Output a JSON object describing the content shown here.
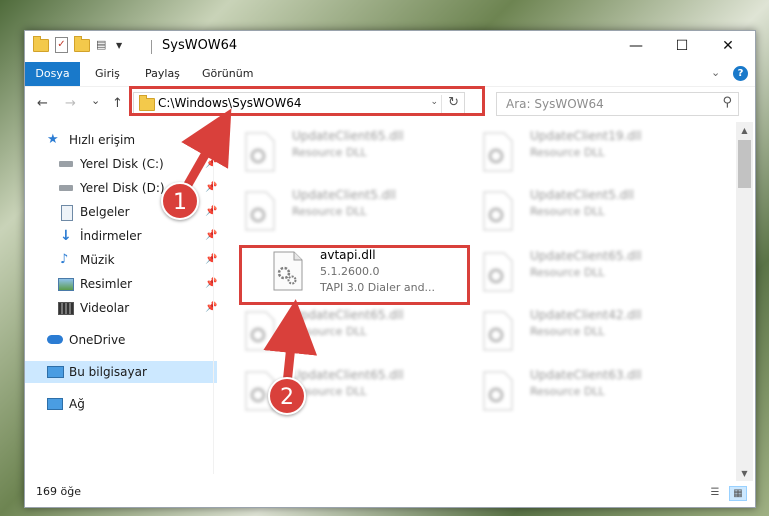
{
  "window": {
    "title": "SysWOW64",
    "controls": {
      "minimize": "—",
      "maximize": "☐",
      "close": "✕"
    }
  },
  "ribbon": {
    "file_tab": "Dosya",
    "tabs": [
      "Giriş",
      "Paylaş",
      "Görünüm"
    ],
    "help": "?"
  },
  "navigation": {
    "back": "←",
    "forward": "→",
    "recent": "⌄",
    "up": "↑",
    "address": "C:\\Windows\\SysWOW64",
    "search_placeholder": "Ara: SysWOW64"
  },
  "sidebar": {
    "quick_access": "Hızlı erişim",
    "items": [
      {
        "label": "Yerel Disk (C:)",
        "icon": "drive-icon"
      },
      {
        "label": "Yerel Disk (D:)",
        "icon": "drive-icon"
      },
      {
        "label": "Belgeler",
        "icon": "documents-icon"
      },
      {
        "label": "İndirmeler",
        "icon": "downloads-icon"
      },
      {
        "label": "Müzik",
        "icon": "music-icon"
      },
      {
        "label": "Resimler",
        "icon": "pictures-icon"
      },
      {
        "label": "Videolar",
        "icon": "videos-icon"
      }
    ],
    "onedrive": "OneDrive",
    "this_pc": "Bu bilgisayar",
    "network": "Ağ"
  },
  "files": {
    "left_column": [
      {
        "name": "UpdateClient65.dll",
        "type": "Resource DLL"
      },
      {
        "name": "UpdateClient5.dll",
        "type": "Resource DLL"
      },
      {
        "name": "UpdateClient65.dll",
        "type": "Resource DLL"
      },
      {
        "name": "UpdateClient65.dll",
        "type": "Resource DLL"
      }
    ],
    "right_column": [
      {
        "name": "UpdateClient19.dll",
        "type": "Resource DLL"
      },
      {
        "name": "UpdateClient5.dll",
        "type": "Resource DLL"
      },
      {
        "name": "UpdateClient65.dll",
        "type": "Resource DLL"
      },
      {
        "name": "UpdateClient42.dll",
        "type": "Resource DLL"
      },
      {
        "name": "UpdateClient63.dll",
        "type": "Resource DLL"
      }
    ],
    "highlighted": {
      "name": "avtapi.dll",
      "version": "5.1.2600.0",
      "description": "TAPI 3.0 Dialer and..."
    }
  },
  "status": {
    "item_count": "169 öğe"
  },
  "annotations": {
    "marker_1": "1",
    "marker_2": "2",
    "color": "#d9403b"
  }
}
